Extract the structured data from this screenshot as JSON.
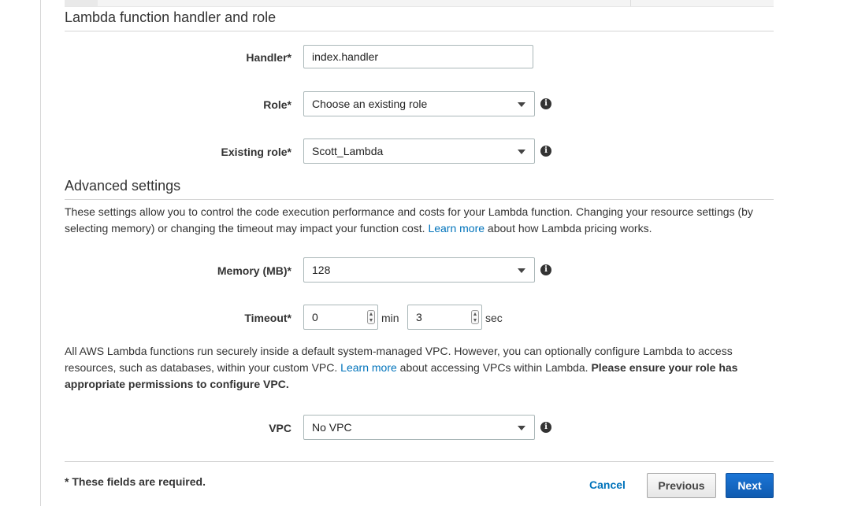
{
  "handler_section": {
    "title": "Lambda function handler and role",
    "handler_label": "Handler*",
    "handler_value": "index.handler",
    "role_label": "Role*",
    "role_value": "Choose an existing role",
    "existing_role_label": "Existing role*",
    "existing_role_value": "Scott_Lambda"
  },
  "advanced": {
    "title": "Advanced settings",
    "desc_before_link": "These settings allow you to control the code execution performance and costs for your Lambda function. Changing your resource settings (by selecting memory) or changing the timeout may impact your function cost. ",
    "desc_link": "Learn more",
    "desc_after_link": " about how Lambda pricing works.",
    "memory_label": "Memory (MB)*",
    "memory_value": "128",
    "timeout_label": "Timeout*",
    "timeout_min_value": "0",
    "timeout_min_unit": "min",
    "timeout_sec_value": "3",
    "timeout_sec_unit": "sec",
    "vpc_text_before_link": "All AWS Lambda functions run securely inside a default system-managed VPC. However, you can optionally configure Lambda to access resources, such as databases, within your custom VPC. ",
    "vpc_link": "Learn more",
    "vpc_text_after_link": " about accessing VPCs within Lambda. ",
    "vpc_text_bold": "Please ensure your role has appropriate permissions to configure VPC.",
    "vpc_label": "VPC",
    "vpc_value": "No VPC"
  },
  "footer": {
    "required_note": "* These fields are required.",
    "cancel_label": "Cancel",
    "previous_label": "Previous",
    "next_label": "Next"
  },
  "icons": {
    "info": "info-circle-icon",
    "dropdown": "caret-down-icon",
    "spinner": "spinner-arrows-icon"
  },
  "colors": {
    "link": "#0073bb",
    "primary_button": "#1566c0"
  }
}
